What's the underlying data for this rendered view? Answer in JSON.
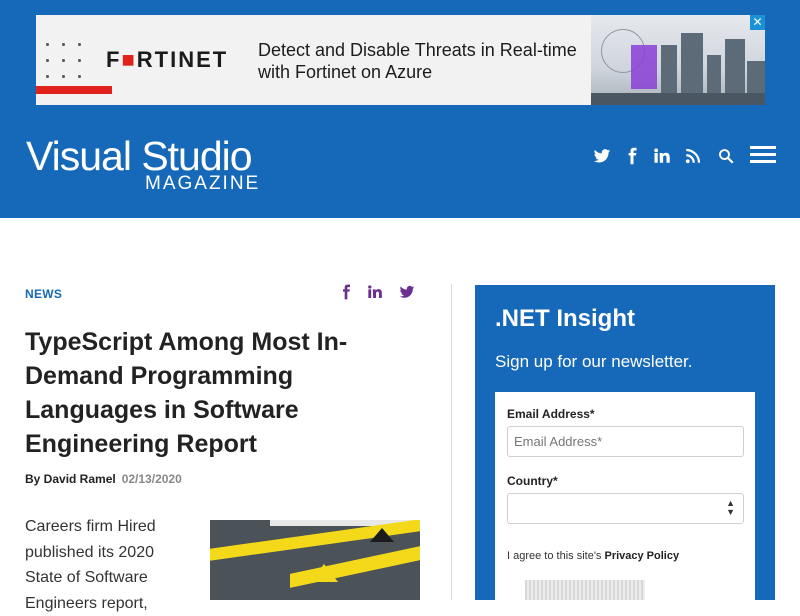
{
  "ad": {
    "brand": "F",
    "brand_o": "■",
    "brand_rest": "RTINET",
    "text": "Detect and Disable Threats in Real-time with Fortinet on Azure",
    "close": "✕",
    "colors": {
      "accent": "#e1221c",
      "close_bg": "#1b92d6"
    }
  },
  "header": {
    "logo_main": "Visual Studio",
    "logo_sub": "MAGAZINE",
    "background": "#1668b8",
    "icons": [
      "twitter-icon",
      "facebook-icon",
      "linkedin-icon",
      "rss-icon",
      "search-icon",
      "menu-icon"
    ]
  },
  "article": {
    "category": "NEWS",
    "title": "TypeScript Among Most In-Demand Programming Languages in Software Engineering Report",
    "author": "By David Ramel",
    "date": "02/13/2020",
    "body": "Careers firm Hired published its 2020 State of Software Engineers report,",
    "share_icons": [
      "facebook-icon",
      "linkedin-icon",
      "twitter-icon"
    ],
    "accent": "#6a2f8f"
  },
  "newsletter": {
    "title": ".NET Insight",
    "subtitle": "Sign up for our newsletter.",
    "email_label": "Email Address*",
    "email_placeholder": "Email Address*",
    "country_label": "Country*",
    "country_value": "",
    "agree_prefix": "I agree to this site's ",
    "agree_link": "Privacy Policy"
  }
}
